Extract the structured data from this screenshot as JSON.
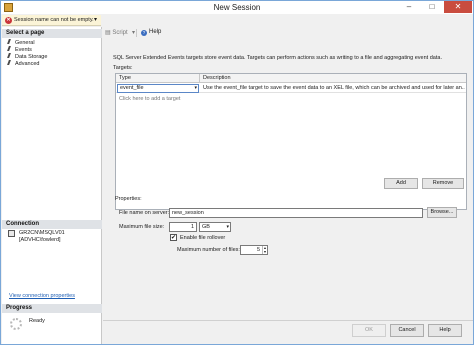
{
  "window": {
    "title": "New Session"
  },
  "message_bar": {
    "text": "Session name can not be empty."
  },
  "toolbar": {
    "script_label": "Script",
    "help_label": "Help"
  },
  "left_pane": {
    "select_page_header": "Select a page",
    "pages": [
      "General",
      "Events",
      "Data Storage",
      "Advanced"
    ],
    "connection_header": "Connection",
    "connection_server": "GR2CN\\MSQLV01",
    "connection_user": "[ADVHC\\fowlerd]",
    "view_connection_link": "View connection properties",
    "progress_header": "Progress",
    "progress_status": "Ready"
  },
  "main": {
    "description": "SQL Server Extended Events targets store event data. Targets can perform actions such as writing to a file and aggregating event data.",
    "targets_label": "Targets:",
    "targets_grid": {
      "columns": [
        "Type",
        "Description"
      ],
      "rows": [
        {
          "type": "event_file",
          "description": "Use the event_file target to save the event data to an XEL file, which can be archived and used for later an..."
        }
      ],
      "add_placeholder": "Click here to add a target"
    },
    "add_button": "Add",
    "remove_button": "Remove",
    "properties_label": "Properties:",
    "file_name_label": "File name on server:",
    "file_name_value": "new_session",
    "browse_button": "Browse...",
    "max_file_size_label": "Maximum file size:",
    "max_file_size_value": "1",
    "max_file_size_unit": "GB",
    "enable_rollover_label": "Enable file rollover",
    "enable_rollover_checked": "✔",
    "max_files_label": "Maximum number of files:",
    "max_files_value": "5"
  },
  "footer": {
    "ok_button": "OK",
    "cancel_button": "Cancel",
    "help_button": "Help"
  }
}
